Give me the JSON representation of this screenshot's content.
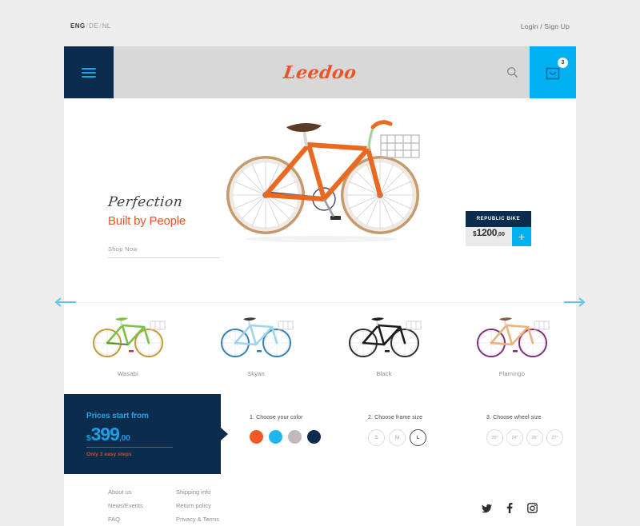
{
  "utility": {
    "languages": [
      "ENG",
      "DE",
      "NL"
    ],
    "active_language": "ENG",
    "account_link": "Login / Sign Up"
  },
  "header": {
    "logo": "Leedoo",
    "menu_icon": "hamburger-menu-icon",
    "search_icon": "search-icon",
    "cart_icon": "shopping-bag-icon",
    "cart_count": "3",
    "accent_blue": "#00b0f0",
    "navy": "#0c2c4e"
  },
  "hero": {
    "script_line": "Perfection",
    "title": "Built by People",
    "cta": "Shop Now",
    "product_badge": "REPUBLIC BIKE",
    "price_currency": "$",
    "price_integer": "1200",
    "price_decimal": ",00",
    "add_button": "+",
    "bike_alt": "orange-city-bike"
  },
  "carousel": {
    "prev_label": "previous",
    "next_label": "next",
    "products": [
      {
        "name": "Wasabi",
        "color": "#7ac143"
      },
      {
        "name": "Skyan",
        "color": "#6fc6ef"
      },
      {
        "name": "Black",
        "color": "#1c1c1c"
      },
      {
        "name": "Flamingo",
        "color": "#f0b07c"
      }
    ]
  },
  "promo": {
    "kicker": "Prices start from",
    "currency": "$",
    "integer": "399",
    "decimal": ",00",
    "note": "Only 3 easy steps"
  },
  "steps": {
    "color": {
      "label": "1. Choose your color",
      "options": [
        {
          "name": "orange",
          "hex": "#ef5a28"
        },
        {
          "name": "blue",
          "hex": "#1fb6f0"
        },
        {
          "name": "grey",
          "hex": "#c3b9bb"
        },
        {
          "name": "navy",
          "hex": "#0c2c4e"
        }
      ],
      "selected": "orange"
    },
    "frame": {
      "label": "2. Choose frame size",
      "options": [
        "S",
        "M",
        "L"
      ],
      "selected": "L"
    },
    "wheel": {
      "label": "3. Choose wheel size",
      "options": [
        "20\"",
        "24\"",
        "26\"",
        "27\""
      ],
      "selected": ""
    }
  },
  "footer": {
    "column_one": [
      "About us",
      "News/Events",
      "FAQ"
    ],
    "column_two": [
      "Shipping info",
      "Return policy",
      "Privacy & Terms"
    ],
    "social": [
      "twitter-icon",
      "facebook-icon",
      "instagram-icon"
    ]
  }
}
